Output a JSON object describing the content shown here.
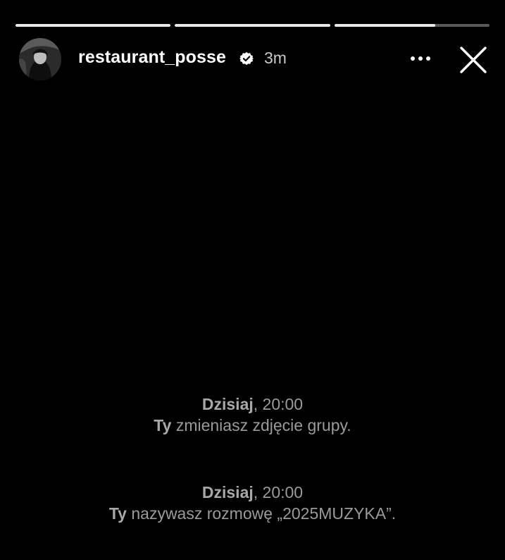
{
  "story": {
    "progress": [
      1.0,
      1.0,
      0.65
    ]
  },
  "header": {
    "username": "restaurant_posse",
    "time": "3m",
    "avatar_icon": "profile-photo",
    "verified_icon": "verified-badge-icon",
    "more_icon": "more-horizontal-icon",
    "close_icon": "close-icon"
  },
  "messages": [
    {
      "day": "Dzisiaj",
      "time": ", 20:00",
      "actor": "Ty",
      "text": " zmieniasz zdjęcie grupy."
    },
    {
      "day": "Dzisiaj",
      "time": ", 20:00",
      "actor": "Ty",
      "text": " nazywasz rozmowę „2025MUZYKA”."
    }
  ],
  "colors": {
    "background": "#000000",
    "text_primary": "#ffffff",
    "text_muted": "#9a9a9a"
  }
}
